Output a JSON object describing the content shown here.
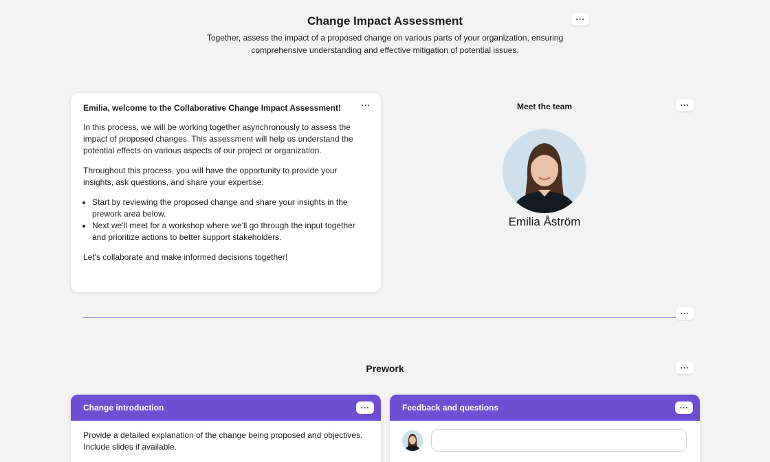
{
  "header": {
    "title": "Change Impact Assessment",
    "subtitle": "Together, assess the impact of a proposed change on various parts of your organization, ensuring comprehensive understanding and effective mitigation of potential issues.",
    "more_icon": "more-horizontal-icon"
  },
  "welcome": {
    "heading": "Emilia, welcome to the Collaborative Change Impact Assessment!",
    "paragraphs": [
      "In this process, we will be working together asynchronously to assess the impact of proposed changes. This assessment will help us understand the potential effects on various aspects of our project or organization.",
      "Throughout this process, you will have the opportunity to provide your insights, ask questions, and share your expertise."
    ],
    "bullets": [
      "Start by reviewing the proposed change and share your insights in the prework area below.",
      "Next we'll meet for a workshop where we'll go through the input together and prioritize actions to better support stakeholders."
    ],
    "closing": "Let's collaborate and make informed decisions together!"
  },
  "team": {
    "title": "Meet the team",
    "members": [
      {
        "name": "Emilia Åström",
        "avatar_icon": "person-avatar-icon"
      }
    ]
  },
  "prework": {
    "title": "Prework",
    "panels": [
      {
        "title": "Change introduction",
        "body": "Provide a detailed explanation of the change being proposed and objectives. Include slides if available."
      },
      {
        "title": "Feedback and questions",
        "input_value": "",
        "input_placeholder": ""
      }
    ]
  },
  "colors": {
    "accent": "#6f4fd1",
    "divider": "#8b86d9",
    "background": "#f3f3f3"
  }
}
